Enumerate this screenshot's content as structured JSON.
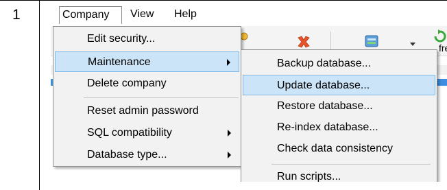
{
  "row_number": "1",
  "menubar": {
    "company": "Company",
    "view": "View",
    "help": "Help"
  },
  "toolbar": {
    "icons": [
      "key-icon",
      "delete-icon",
      "database-icon",
      "dropdown-arrow-icon",
      "refresh-icon"
    ],
    "refresh_label": "fre"
  },
  "company_menu": {
    "items": [
      {
        "label": "Edit security...",
        "submenu": false
      },
      {
        "label": "Maintenance",
        "submenu": true,
        "highlighted": true
      },
      {
        "label": "Delete company",
        "submenu": false
      },
      {
        "label": "Reset admin password",
        "submenu": false
      },
      {
        "label": "SQL compatibility",
        "submenu": true
      },
      {
        "label": "Database type...",
        "submenu": true
      }
    ]
  },
  "maintenance_menu": {
    "items": [
      {
        "label": "Backup database..."
      },
      {
        "label": "Update database...",
        "highlighted": true
      },
      {
        "label": "Restore database..."
      },
      {
        "label": "Re-index database..."
      },
      {
        "label": "Check data consistency"
      },
      {
        "label": "Run scripts..."
      }
    ]
  },
  "colors": {
    "menu_bg": "#f2f2f2",
    "highlight_bg": "#cce4f7",
    "highlight_border": "#7db8e6",
    "selection_blue": "#3d8ee0"
  }
}
